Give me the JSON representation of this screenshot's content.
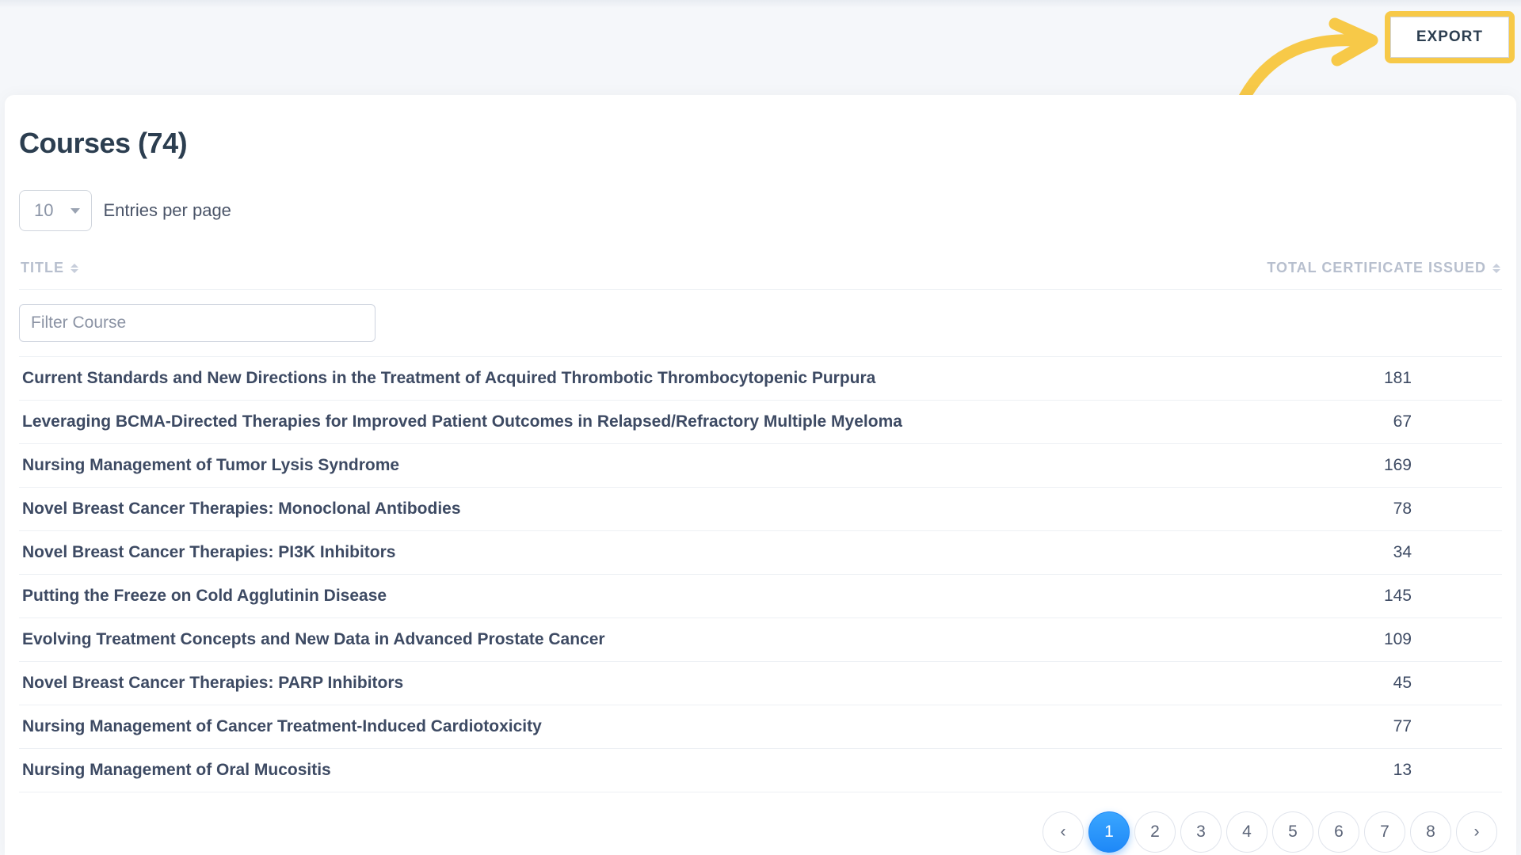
{
  "export": {
    "label": "EXPORT"
  },
  "page": {
    "title": "Courses (74)"
  },
  "entries": {
    "value": "10",
    "label": "Entries per page"
  },
  "columns": {
    "title": "TITLE",
    "count": "TOTAL CERTIFICATE ISSUED"
  },
  "filter": {
    "placeholder": "Filter Course"
  },
  "rows": [
    {
      "title": "Current Standards and New Directions in the Treatment of Acquired Thrombotic Thrombocytopenic Purpura",
      "count": "181"
    },
    {
      "title": "Leveraging BCMA-Directed Therapies for Improved Patient Outcomes in Relapsed/Refractory Multiple Myeloma",
      "count": "67"
    },
    {
      "title": "Nursing Management of Tumor Lysis Syndrome",
      "count": "169"
    },
    {
      "title": "Novel Breast Cancer Therapies: Monoclonal Antibodies",
      "count": "78"
    },
    {
      "title": "Novel Breast Cancer Therapies: PI3K Inhibitors",
      "count": "34"
    },
    {
      "title": "Putting the Freeze on Cold Agglutinin Disease",
      "count": "145"
    },
    {
      "title": "Evolving Treatment Concepts and New Data in Advanced Prostate Cancer",
      "count": "109"
    },
    {
      "title": "Novel Breast Cancer Therapies: PARP Inhibitors",
      "count": "45"
    },
    {
      "title": "Nursing Management of Cancer Treatment-Induced Cardiotoxicity",
      "count": "77"
    },
    {
      "title": "Nursing Management of Oral Mucositis",
      "count": "13"
    }
  ],
  "pagination": {
    "prev": "‹",
    "next": "›",
    "pages": [
      "1",
      "2",
      "3",
      "4",
      "5",
      "6",
      "7",
      "8"
    ],
    "active": "1"
  }
}
